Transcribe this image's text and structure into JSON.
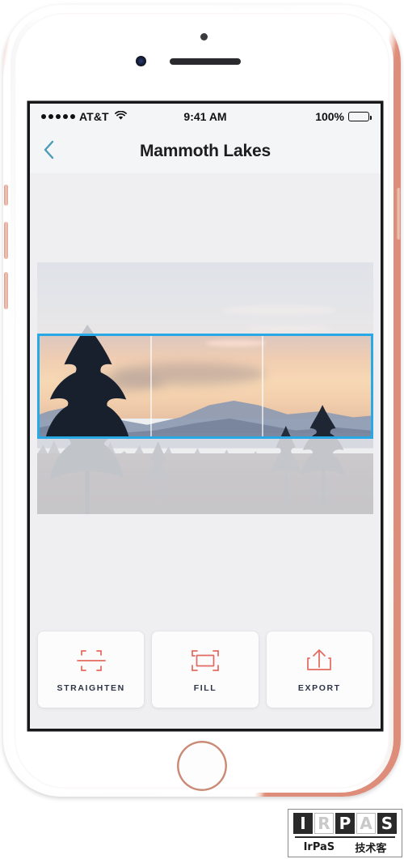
{
  "device": {
    "model_color": "rose-gold",
    "frame_accent": "#e7a090"
  },
  "status_bar": {
    "carrier": "AT&T",
    "signal_dots": 5,
    "wifi_icon": "wifi-icon",
    "time": "9:41 AM",
    "battery_percent": "100%",
    "battery_level": 100
  },
  "nav_bar": {
    "back_icon": "chevron-left-icon",
    "back_accent": "#4a9cb8",
    "title": "Mammoth Lakes"
  },
  "editor": {
    "photo_alt": "Sunset mountain landscape with pine trees",
    "crop_selection": {
      "border_color": "#29a8e6",
      "panels": 3,
      "divider_color": "#ffffff"
    }
  },
  "toolbar": {
    "accent_color": "#e2695f",
    "label_color": "#2b3345",
    "buttons": [
      {
        "label": "STRAIGHTEN",
        "icon": "straighten-icon"
      },
      {
        "label": "FILL",
        "icon": "fill-icon"
      },
      {
        "label": "EXPORT",
        "icon": "export-icon"
      }
    ]
  },
  "watermark": {
    "letters": [
      "I",
      "R",
      "P",
      "A",
      "S"
    ],
    "brand": "IrPaS",
    "subtitle": "技术客"
  }
}
